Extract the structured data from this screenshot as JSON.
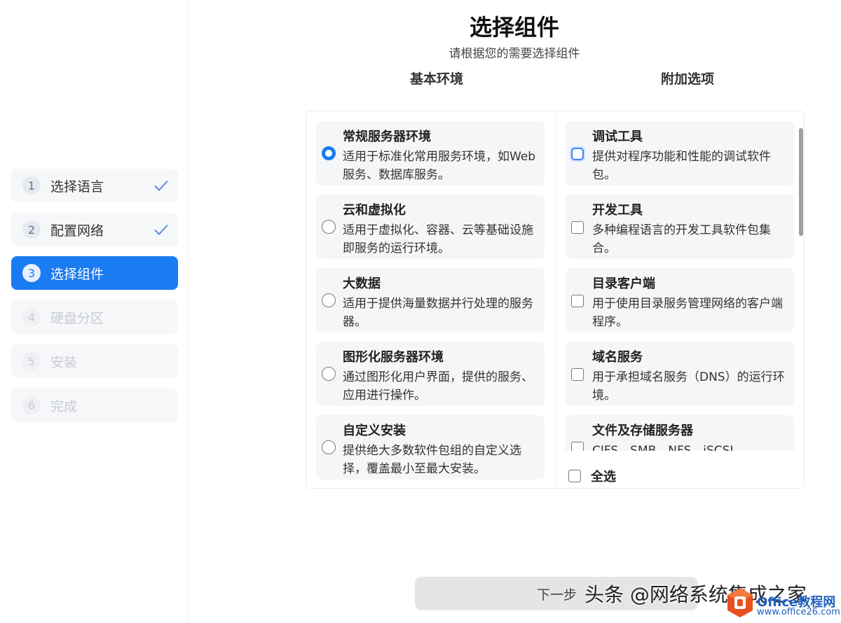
{
  "header": {
    "title": "选择组件",
    "subtitle": "请根据您的需要选择组件"
  },
  "columns": {
    "base_label": "基本环境",
    "addon_label": "附加选项"
  },
  "steps": [
    {
      "num": "1",
      "label": "选择语言",
      "state": "done"
    },
    {
      "num": "2",
      "label": "配置网络",
      "state": "done"
    },
    {
      "num": "3",
      "label": "选择组件",
      "state": "active"
    },
    {
      "num": "4",
      "label": "硬盘分区",
      "state": "disabled"
    },
    {
      "num": "5",
      "label": "安装",
      "state": "disabled"
    },
    {
      "num": "6",
      "label": "完成",
      "state": "disabled"
    }
  ],
  "base_envs": [
    {
      "title": "常规服务器环境",
      "desc": "适用于标准化常用服务环境，如Web服务、数据库服务。",
      "selected": true
    },
    {
      "title": "云和虚拟化",
      "desc": "适用于虚拟化、容器、云等基础设施即服务的运行环境。",
      "selected": false
    },
    {
      "title": "大数据",
      "desc": "适用于提供海量数据并行处理的服务器。",
      "selected": false
    },
    {
      "title": "图形化服务器环境",
      "desc": "通过图形化用户界面，提供的服务、应用进行操作。",
      "selected": false
    },
    {
      "title": "自定义安装",
      "desc": "提供绝大多数软件包组的自定义选择，覆盖最小至最大安装。",
      "selected": false
    }
  ],
  "addons": [
    {
      "title": "调试工具",
      "desc": "提供对程序功能和性能的调试软件包。",
      "checked": false
    },
    {
      "title": "开发工具",
      "desc": "多种编程语言的开发工具软件包集合。",
      "checked": false
    },
    {
      "title": "目录客户端",
      "desc": "用于使用目录服务管理网络的客户端程序。",
      "checked": false
    },
    {
      "title": "域名服务",
      "desc": "用于承担域名服务（DNS）的运行环境。",
      "checked": false
    },
    {
      "title": "文件及存储服务器",
      "desc": "CIFS、SMB、NFS、iSCSI",
      "checked": false
    }
  ],
  "select_all_label": "全选",
  "next_button_label": "下一步",
  "watermark_text": "头条 @网络系统集成之家",
  "logo": {
    "line1": "Office教程网",
    "line2": "www.office26.com"
  },
  "colors": {
    "accent": "#1a7bf2",
    "card_bg": "#f5f6f8",
    "button_bg": "#e5e5e5"
  }
}
